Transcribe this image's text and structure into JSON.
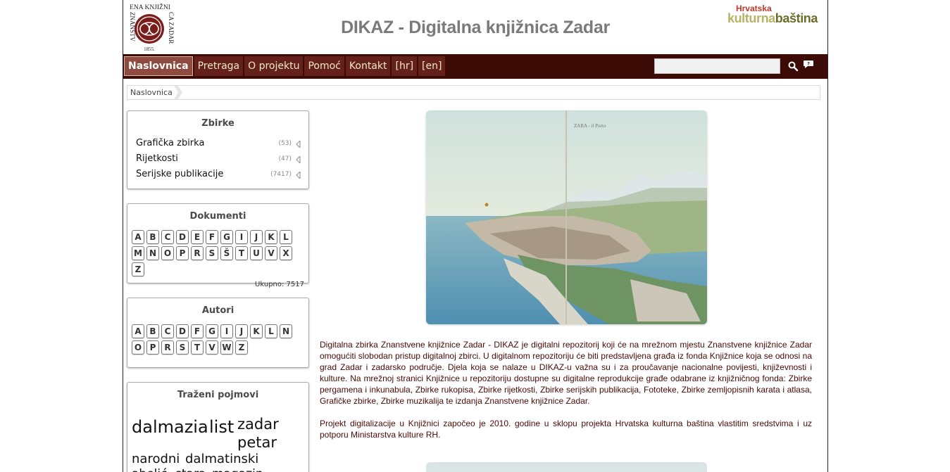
{
  "header": {
    "logo_top": "ENA KNJIŽNI",
    "logo_left": "ZNANSTV",
    "logo_right": "CA ZADAR",
    "logo_year": "1855.",
    "title": "DIKAZ - Digitalna knjižnica Zadar",
    "partner_top": "Hrvatska",
    "partner_bottom_a": "kulturna",
    "partner_bottom_b": "baština"
  },
  "nav": {
    "items": [
      "Naslovnica",
      "Pretraga",
      "O projektu",
      "Pomoć",
      "Kontakt",
      "[hr]",
      "[en]"
    ],
    "active_index": 0
  },
  "search": {
    "value": "",
    "icon": "search-icon",
    "help_icon": "speech-bubble-icon"
  },
  "breadcrumb": {
    "items": [
      "Naslovnica"
    ]
  },
  "collections": {
    "title": "Zbirke",
    "items": [
      {
        "label": "Grafička zbirka",
        "count": "(53)"
      },
      {
        "label": "Rijetkosti",
        "count": "(47)"
      },
      {
        "label": "Serijske publikacije",
        "count": "(7417)"
      }
    ]
  },
  "documents": {
    "title": "Dokumenti",
    "letters": [
      "A",
      "B",
      "C",
      "D",
      "E",
      "F",
      "G",
      "I",
      "J",
      "K",
      "L",
      "M",
      "N",
      "O",
      "P",
      "R",
      "S",
      "Š",
      "T",
      "U",
      "V",
      "X",
      "Z"
    ],
    "total": "Ukupno: 7517"
  },
  "authors": {
    "title": "Autori",
    "letters": [
      "A",
      "B",
      "C",
      "D",
      "F",
      "G",
      "I",
      "J",
      "K",
      "L",
      "N",
      "O",
      "P",
      "R",
      "S",
      "T",
      "V",
      "W",
      "Z"
    ]
  },
  "tags": {
    "title": "Traženi pojmovi",
    "items": [
      {
        "label": "dalmazia",
        "size": 24
      },
      {
        "label": "list",
        "size": 24
      },
      {
        "label": "zadar",
        "size": 21
      },
      {
        "label": "petar",
        "size": 21
      },
      {
        "label": "narodni",
        "size": 18
      },
      {
        "label": "dalmatinski",
        "size": 18
      },
      {
        "label": "abelić",
        "size": 17
      },
      {
        "label": "stara",
        "size": 17
      },
      {
        "label": "magazin",
        "size": 17
      }
    ]
  },
  "main": {
    "image_caption": "ZARA - il Porto",
    "paragraphs": [
      "Digitalna zbirka Znanstvene knjižnice Zadar - DIKAZ je digitalni repozitorij koji će na mrežnom mjestu Znanstvene knjižnice Zadar omogućiti slobodan pristup digitalnoj zbirci. U digitalnom repozitoriju će biti predstavljena građa iz fonda Knjižnice koja se odnosi na grad Zadar i zadarsko područje.  Djela koja se nalaze u DIKAZ-u  važna su i za proučavanje nacionalne povijesti, književnosti i kulture. Na mrežnoj stranici Knjižnice u repozitoriju dostupne su digitalne reprodukcije građe odabrane iz knjižničnog fonda: Zbirke pergamena i inkunabula, Zbirke rukopisa, Zbirke rijetkosti, Zbirke serijskih publikacija, Fototeke, Zbirke zemljopisnih karata i atlasa, Grafičke zbirke, Zbirke muzikalija te izdanja Znanstvene knjižnice Zadar.",
      "Projekt digitalizacije u Knjižnici započeo je 2010. godine u sklopu projekta Hrvatska kulturna baština  vlastitim sredstvima i uz potporu Ministarstva kulture RH."
    ]
  }
}
